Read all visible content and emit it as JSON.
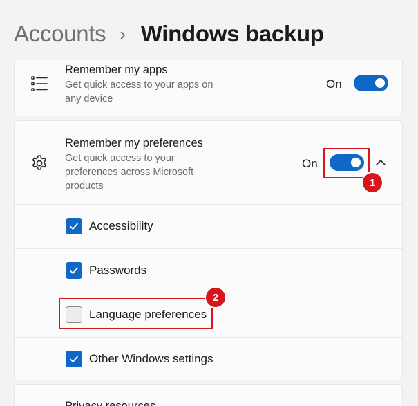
{
  "breadcrumb": {
    "parent": "Accounts",
    "separator": "›",
    "current": "Windows backup"
  },
  "remember_apps": {
    "icon": "list-icon",
    "title": "Remember my apps",
    "description": "Get quick access to your apps on any device",
    "state_label": "On",
    "enabled": true
  },
  "remember_preferences": {
    "icon": "gear-icon",
    "title": "Remember my preferences",
    "description": "Get quick access to your preferences across Microsoft products",
    "state_label": "On",
    "enabled": true,
    "expanded": true,
    "options": [
      {
        "label": "Accessibility",
        "checked": true
      },
      {
        "label": "Passwords",
        "checked": true
      },
      {
        "label": "Language preferences",
        "checked": false
      },
      {
        "label": "Other Windows settings",
        "checked": true
      }
    ]
  },
  "privacy_resources": {
    "title": "Privacy resources"
  },
  "annotations": {
    "marker_1": "1",
    "marker_2": "2"
  },
  "colors": {
    "accent": "#0f67c6",
    "highlight": "#d9141a",
    "background": "#f3f3f3",
    "card": "#fbfbfb"
  }
}
